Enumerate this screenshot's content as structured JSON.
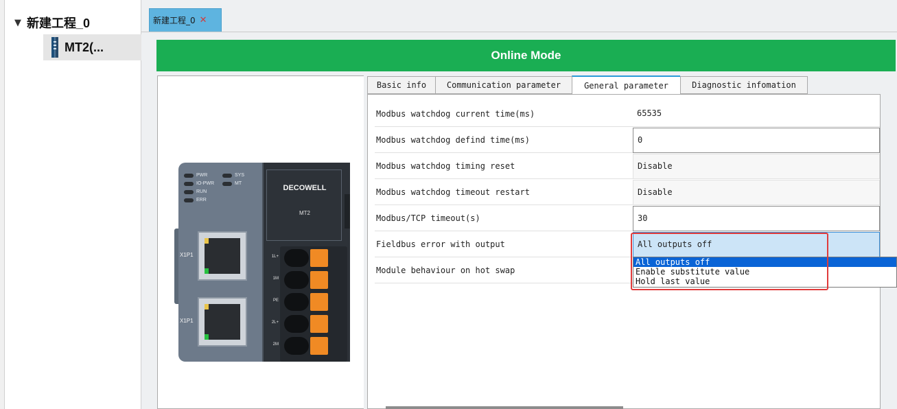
{
  "tree": {
    "root_label": "新建工程_0",
    "root_arrow": "▼",
    "child_label": "MT2(..."
  },
  "doc_tab": {
    "label": "新建工程_0",
    "close_glyph": "✕"
  },
  "banner": {
    "text": "Online Mode",
    "color": "#1aae53"
  },
  "device": {
    "brand": "DECOWELL",
    "model": "MT2",
    "leds": [
      "PWR",
      "SYS",
      "IO-PWR",
      "MT",
      "RUN",
      "ERR"
    ],
    "ports": [
      "X1P1",
      "X1P1"
    ],
    "terminals": [
      "1L+",
      "1M",
      "PE",
      "2L+",
      "2M"
    ]
  },
  "tabs": [
    {
      "label": "Basic info"
    },
    {
      "label": "Communication parameter"
    },
    {
      "label": "General parameter"
    },
    {
      "label": "Diagnostic infomation"
    }
  ],
  "params": [
    {
      "label": "Modbus watchdog current time(ms)",
      "value": "65535"
    },
    {
      "label": "Modbus watchdog defind time(ms)",
      "value": "0"
    },
    {
      "label": "Modbus watchdog timing reset",
      "value": "Disable"
    },
    {
      "label": "Modbus watchdog timeout restart",
      "value": "Disable"
    },
    {
      "label": "Modbus/TCP timeout(s)",
      "value": "30"
    },
    {
      "label": "Fieldbus error with output",
      "value": "All outputs off"
    },
    {
      "label": "Module behaviour on hot swap",
      "value": ""
    }
  ],
  "dropdown": {
    "options": [
      "All outputs off",
      "Enable substitute value",
      "Hold last value"
    ],
    "selected": "All outputs off"
  }
}
